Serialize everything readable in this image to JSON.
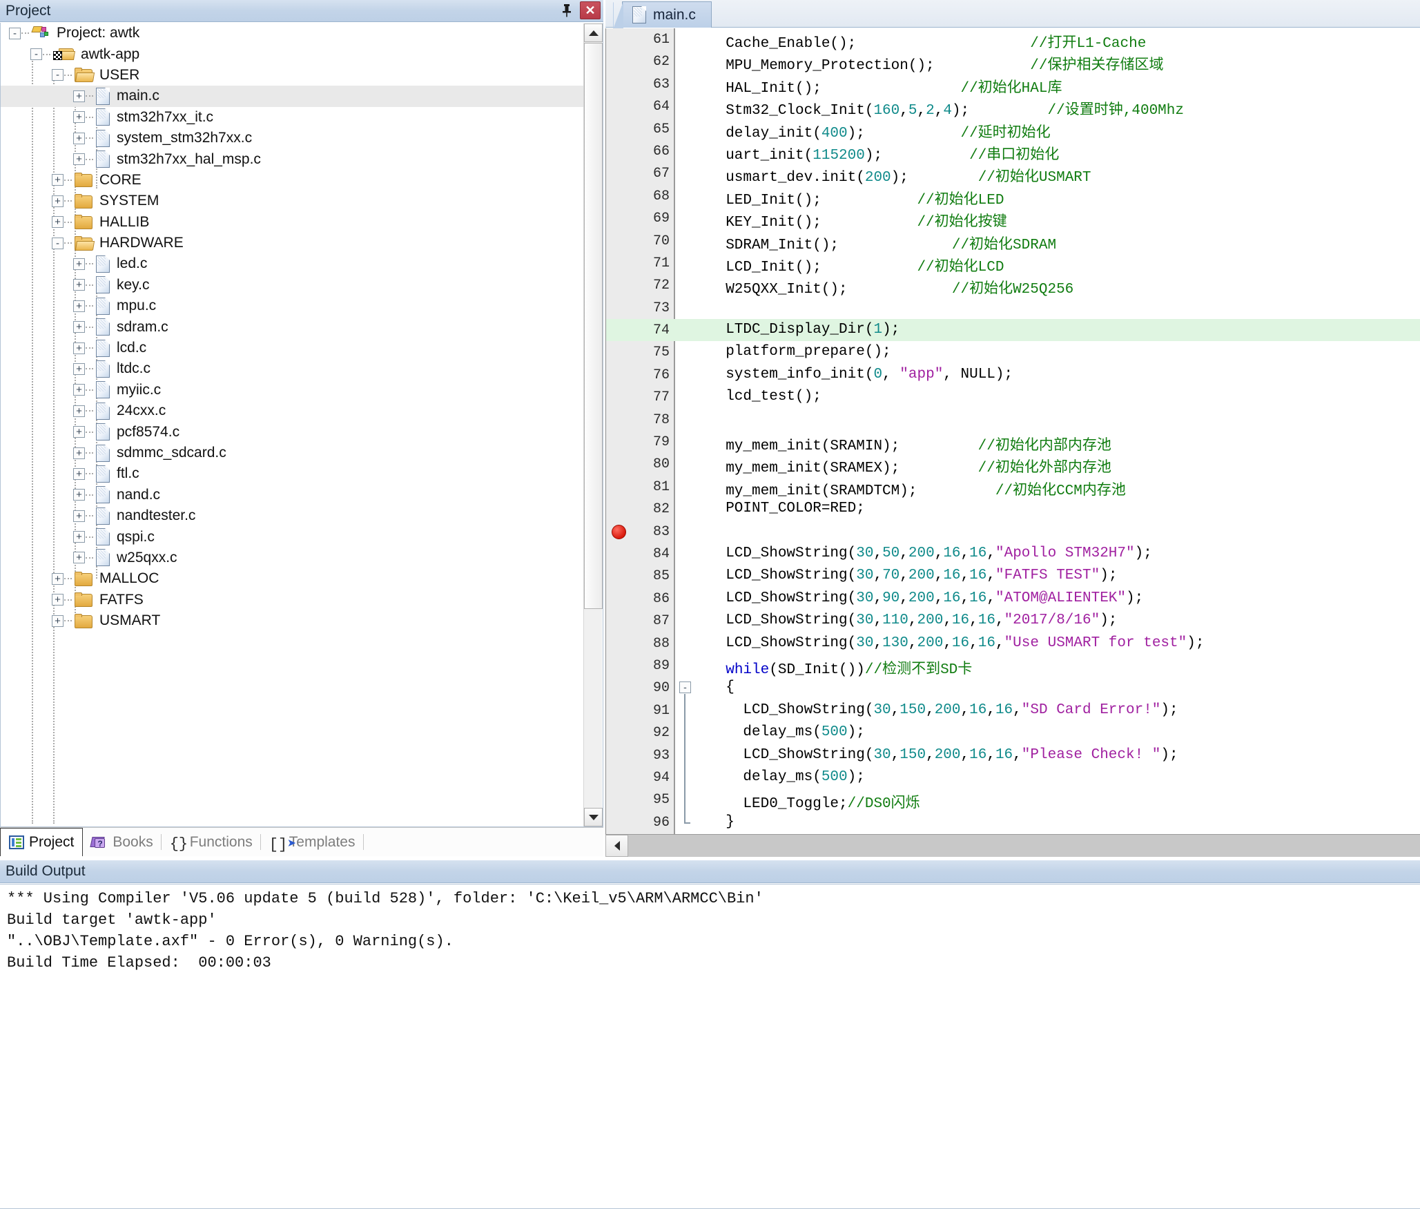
{
  "project_pane": {
    "title": "Project",
    "pin_icon": "pin-icon",
    "close_icon": "close-icon",
    "tree": [
      {
        "indent": 0,
        "toggle": "-",
        "icon": "project-icon",
        "label": "Project: awtk",
        "selected": false
      },
      {
        "indent": 1,
        "toggle": "-",
        "icon": "target-icon",
        "label": "awtk-app",
        "selected": false
      },
      {
        "indent": 2,
        "toggle": "-",
        "icon": "folder-open",
        "label": "USER",
        "selected": false
      },
      {
        "indent": 3,
        "toggle": "+",
        "icon": "file-icon",
        "label": "main.c",
        "selected": true
      },
      {
        "indent": 3,
        "toggle": "+",
        "icon": "file-icon",
        "label": "stm32h7xx_it.c",
        "selected": false
      },
      {
        "indent": 3,
        "toggle": "+",
        "icon": "file-icon",
        "label": "system_stm32h7xx.c",
        "selected": false
      },
      {
        "indent": 3,
        "toggle": "+",
        "icon": "file-icon",
        "label": "stm32h7xx_hal_msp.c",
        "selected": false
      },
      {
        "indent": 2,
        "toggle": "+",
        "icon": "folder",
        "label": "CORE",
        "selected": false
      },
      {
        "indent": 2,
        "toggle": "+",
        "icon": "folder",
        "label": "SYSTEM",
        "selected": false
      },
      {
        "indent": 2,
        "toggle": "+",
        "icon": "folder",
        "label": "HALLIB",
        "selected": false
      },
      {
        "indent": 2,
        "toggle": "-",
        "icon": "folder-open",
        "label": "HARDWARE",
        "selected": false
      },
      {
        "indent": 3,
        "toggle": "+",
        "icon": "file-icon",
        "label": "led.c",
        "selected": false
      },
      {
        "indent": 3,
        "toggle": "+",
        "icon": "file-icon",
        "label": "key.c",
        "selected": false
      },
      {
        "indent": 3,
        "toggle": "+",
        "icon": "file-icon",
        "label": "mpu.c",
        "selected": false
      },
      {
        "indent": 3,
        "toggle": "+",
        "icon": "file-icon",
        "label": "sdram.c",
        "selected": false
      },
      {
        "indent": 3,
        "toggle": "+",
        "icon": "file-icon",
        "label": "lcd.c",
        "selected": false
      },
      {
        "indent": 3,
        "toggle": "+",
        "icon": "file-icon",
        "label": "ltdc.c",
        "selected": false
      },
      {
        "indent": 3,
        "toggle": "+",
        "icon": "file-icon",
        "label": "myiic.c",
        "selected": false
      },
      {
        "indent": 3,
        "toggle": "+",
        "icon": "file-icon",
        "label": "24cxx.c",
        "selected": false
      },
      {
        "indent": 3,
        "toggle": "+",
        "icon": "file-icon",
        "label": "pcf8574.c",
        "selected": false
      },
      {
        "indent": 3,
        "toggle": "+",
        "icon": "file-icon",
        "label": "sdmmc_sdcard.c",
        "selected": false
      },
      {
        "indent": 3,
        "toggle": "+",
        "icon": "file-icon",
        "label": "ftl.c",
        "selected": false
      },
      {
        "indent": 3,
        "toggle": "+",
        "icon": "file-icon",
        "label": "nand.c",
        "selected": false
      },
      {
        "indent": 3,
        "toggle": "+",
        "icon": "file-icon",
        "label": "nandtester.c",
        "selected": false
      },
      {
        "indent": 3,
        "toggle": "+",
        "icon": "file-icon",
        "label": "qspi.c",
        "selected": false
      },
      {
        "indent": 3,
        "toggle": "+",
        "icon": "file-icon",
        "label": "w25qxx.c",
        "selected": false
      },
      {
        "indent": 2,
        "toggle": "+",
        "icon": "folder",
        "label": "MALLOC",
        "selected": false
      },
      {
        "indent": 2,
        "toggle": "+",
        "icon": "folder",
        "label": "FATFS",
        "selected": false
      },
      {
        "indent": 2,
        "toggle": "+",
        "icon": "folder",
        "label": "USMART",
        "selected": false
      }
    ],
    "tabs": [
      {
        "label": "Project",
        "icon": "project-list-icon",
        "active": true
      },
      {
        "label": "Books",
        "icon": "books-icon",
        "active": false
      },
      {
        "label": "Functions",
        "icon": "functions-icon",
        "active": false
      },
      {
        "label": "Templates",
        "icon": "templates-icon",
        "active": false
      }
    ],
    "scrollbar": {
      "up_icon": "scroll-up-arrow",
      "down_icon": "scroll-down-arrow"
    }
  },
  "editor": {
    "tab": {
      "label": "main.c",
      "icon": "file-icon",
      "active": true
    },
    "hscroll_left_icon": "scroll-left-arrow",
    "breakpoint_line": 83,
    "highlight_line": 74,
    "lines": [
      {
        "num": 61,
        "tokens": [
          {
            "t": "  Cache_Enable();",
            "c": "p"
          },
          {
            "t": "                    //打开L1-Cache",
            "c": "c"
          }
        ]
      },
      {
        "num": 62,
        "tokens": [
          {
            "t": "  MPU_Memory_Protection();",
            "c": "p"
          },
          {
            "t": "           //保护相关存储区域",
            "c": "c"
          }
        ]
      },
      {
        "num": 63,
        "tokens": [
          {
            "t": "  HAL_Init();",
            "c": "p"
          },
          {
            "t": "                //初始化HAL库",
            "c": "c"
          }
        ]
      },
      {
        "num": 64,
        "tokens": [
          {
            "t": "  Stm32_Clock_Init(",
            "c": "p"
          },
          {
            "t": "160",
            "c": "n"
          },
          {
            "t": ",",
            "c": "p"
          },
          {
            "t": "5",
            "c": "n"
          },
          {
            "t": ",",
            "c": "p"
          },
          {
            "t": "2",
            "c": "n"
          },
          {
            "t": ",",
            "c": "p"
          },
          {
            "t": "4",
            "c": "n"
          },
          {
            "t": ");",
            "c": "p"
          },
          {
            "t": "         //设置时钟,400Mhz",
            "c": "c"
          }
        ]
      },
      {
        "num": 65,
        "tokens": [
          {
            "t": "  delay_init(",
            "c": "p"
          },
          {
            "t": "400",
            "c": "n"
          },
          {
            "t": ");",
            "c": "p"
          },
          {
            "t": "           //延时初始化",
            "c": "c"
          }
        ]
      },
      {
        "num": 66,
        "tokens": [
          {
            "t": "  uart_init(",
            "c": "p"
          },
          {
            "t": "115200",
            "c": "n"
          },
          {
            "t": ");",
            "c": "p"
          },
          {
            "t": "          //串口初始化",
            "c": "c"
          }
        ]
      },
      {
        "num": 67,
        "tokens": [
          {
            "t": "  usmart_dev.init(",
            "c": "p"
          },
          {
            "t": "200",
            "c": "n"
          },
          {
            "t": ");",
            "c": "p"
          },
          {
            "t": "        //初始化USMART",
            "c": "c"
          }
        ]
      },
      {
        "num": 68,
        "tokens": [
          {
            "t": "  LED_Init();",
            "c": "p"
          },
          {
            "t": "           //初始化LED",
            "c": "c"
          }
        ]
      },
      {
        "num": 69,
        "tokens": [
          {
            "t": "  KEY_Init();",
            "c": "p"
          },
          {
            "t": "           //初始化按键",
            "c": "c"
          }
        ]
      },
      {
        "num": 70,
        "tokens": [
          {
            "t": "  SDRAM_Init();",
            "c": "p"
          },
          {
            "t": "             //初始化SDRAM",
            "c": "c"
          }
        ]
      },
      {
        "num": 71,
        "tokens": [
          {
            "t": "  LCD_Init();",
            "c": "p"
          },
          {
            "t": "           //初始化LCD",
            "c": "c"
          }
        ]
      },
      {
        "num": 72,
        "tokens": [
          {
            "t": "  W25QXX_Init();",
            "c": "p"
          },
          {
            "t": "            //初始化W25Q256",
            "c": "c"
          }
        ]
      },
      {
        "num": 73,
        "tokens": []
      },
      {
        "num": 74,
        "tokens": [
          {
            "t": "  LTDC_Display_Dir(",
            "c": "p"
          },
          {
            "t": "1",
            "c": "n"
          },
          {
            "t": ");",
            "c": "p"
          }
        ]
      },
      {
        "num": 75,
        "tokens": [
          {
            "t": "  platform_prepare();",
            "c": "p"
          }
        ]
      },
      {
        "num": 76,
        "tokens": [
          {
            "t": "  system_info_init(",
            "c": "p"
          },
          {
            "t": "0",
            "c": "n"
          },
          {
            "t": ", ",
            "c": "p"
          },
          {
            "t": "\"app\"",
            "c": "s"
          },
          {
            "t": ", NULL);",
            "c": "p"
          }
        ]
      },
      {
        "num": 77,
        "tokens": [
          {
            "t": "  lcd_test();",
            "c": "p"
          }
        ]
      },
      {
        "num": 78,
        "tokens": []
      },
      {
        "num": 79,
        "tokens": [
          {
            "t": "  my_mem_init(SRAMIN);",
            "c": "p"
          },
          {
            "t": "         //初始化内部内存池",
            "c": "c"
          }
        ]
      },
      {
        "num": 80,
        "tokens": [
          {
            "t": "  my_mem_init(SRAMEX);",
            "c": "p"
          },
          {
            "t": "         //初始化外部内存池",
            "c": "c"
          }
        ]
      },
      {
        "num": 81,
        "tokens": [
          {
            "t": "  my_mem_init(SRAMDTCM);",
            "c": "p"
          },
          {
            "t": "         //初始化CCM内存池",
            "c": "c"
          }
        ]
      },
      {
        "num": 82,
        "tokens": [
          {
            "t": "  POINT_COLOR=RED;",
            "c": "p"
          }
        ]
      },
      {
        "num": 83,
        "tokens": []
      },
      {
        "num": 84,
        "tokens": [
          {
            "t": "  LCD_ShowString(",
            "c": "p"
          },
          {
            "t": "30",
            "c": "n"
          },
          {
            "t": ",",
            "c": "p"
          },
          {
            "t": "50",
            "c": "n"
          },
          {
            "t": ",",
            "c": "p"
          },
          {
            "t": "200",
            "c": "n"
          },
          {
            "t": ",",
            "c": "p"
          },
          {
            "t": "16",
            "c": "n"
          },
          {
            "t": ",",
            "c": "p"
          },
          {
            "t": "16",
            "c": "n"
          },
          {
            "t": ",",
            "c": "p"
          },
          {
            "t": "\"Apollo STM32H7\"",
            "c": "s"
          },
          {
            "t": ");",
            "c": "p"
          }
        ]
      },
      {
        "num": 85,
        "tokens": [
          {
            "t": "  LCD_ShowString(",
            "c": "p"
          },
          {
            "t": "30",
            "c": "n"
          },
          {
            "t": ",",
            "c": "p"
          },
          {
            "t": "70",
            "c": "n"
          },
          {
            "t": ",",
            "c": "p"
          },
          {
            "t": "200",
            "c": "n"
          },
          {
            "t": ",",
            "c": "p"
          },
          {
            "t": "16",
            "c": "n"
          },
          {
            "t": ",",
            "c": "p"
          },
          {
            "t": "16",
            "c": "n"
          },
          {
            "t": ",",
            "c": "p"
          },
          {
            "t": "\"FATFS TEST\"",
            "c": "s"
          },
          {
            "t": ");",
            "c": "p"
          }
        ]
      },
      {
        "num": 86,
        "tokens": [
          {
            "t": "  LCD_ShowString(",
            "c": "p"
          },
          {
            "t": "30",
            "c": "n"
          },
          {
            "t": ",",
            "c": "p"
          },
          {
            "t": "90",
            "c": "n"
          },
          {
            "t": ",",
            "c": "p"
          },
          {
            "t": "200",
            "c": "n"
          },
          {
            "t": ",",
            "c": "p"
          },
          {
            "t": "16",
            "c": "n"
          },
          {
            "t": ",",
            "c": "p"
          },
          {
            "t": "16",
            "c": "n"
          },
          {
            "t": ",",
            "c": "p"
          },
          {
            "t": "\"ATOM@ALIENTEK\"",
            "c": "s"
          },
          {
            "t": ");",
            "c": "p"
          }
        ]
      },
      {
        "num": 87,
        "tokens": [
          {
            "t": "  LCD_ShowString(",
            "c": "p"
          },
          {
            "t": "30",
            "c": "n"
          },
          {
            "t": ",",
            "c": "p"
          },
          {
            "t": "110",
            "c": "n"
          },
          {
            "t": ",",
            "c": "p"
          },
          {
            "t": "200",
            "c": "n"
          },
          {
            "t": ",",
            "c": "p"
          },
          {
            "t": "16",
            "c": "n"
          },
          {
            "t": ",",
            "c": "p"
          },
          {
            "t": "16",
            "c": "n"
          },
          {
            "t": ",",
            "c": "p"
          },
          {
            "t": "\"2017/8/16\"",
            "c": "s"
          },
          {
            "t": ");",
            "c": "p"
          }
        ]
      },
      {
        "num": 88,
        "tokens": [
          {
            "t": "  LCD_ShowString(",
            "c": "p"
          },
          {
            "t": "30",
            "c": "n"
          },
          {
            "t": ",",
            "c": "p"
          },
          {
            "t": "130",
            "c": "n"
          },
          {
            "t": ",",
            "c": "p"
          },
          {
            "t": "200",
            "c": "n"
          },
          {
            "t": ",",
            "c": "p"
          },
          {
            "t": "16",
            "c": "n"
          },
          {
            "t": ",",
            "c": "p"
          },
          {
            "t": "16",
            "c": "n"
          },
          {
            "t": ",",
            "c": "p"
          },
          {
            "t": "\"Use USMART for test\"",
            "c": "s"
          },
          {
            "t": ");",
            "c": "p"
          }
        ]
      },
      {
        "num": 89,
        "tokens": [
          {
            "t": "  ",
            "c": "p"
          },
          {
            "t": "while",
            "c": "k"
          },
          {
            "t": "(SD_Init())",
            "c": "p"
          },
          {
            "t": "//检测不到SD卡",
            "c": "c"
          }
        ]
      },
      {
        "num": 90,
        "tokens": [
          {
            "t": "  {",
            "c": "p"
          }
        ],
        "fold": "-"
      },
      {
        "num": 91,
        "tokens": [
          {
            "t": "    LCD_ShowString(",
            "c": "p"
          },
          {
            "t": "30",
            "c": "n"
          },
          {
            "t": ",",
            "c": "p"
          },
          {
            "t": "150",
            "c": "n"
          },
          {
            "t": ",",
            "c": "p"
          },
          {
            "t": "200",
            "c": "n"
          },
          {
            "t": ",",
            "c": "p"
          },
          {
            "t": "16",
            "c": "n"
          },
          {
            "t": ",",
            "c": "p"
          },
          {
            "t": "16",
            "c": "n"
          },
          {
            "t": ",",
            "c": "p"
          },
          {
            "t": "\"SD Card Error!\"",
            "c": "s"
          },
          {
            "t": ");",
            "c": "p"
          }
        ]
      },
      {
        "num": 92,
        "tokens": [
          {
            "t": "    delay_ms(",
            "c": "p"
          },
          {
            "t": "500",
            "c": "n"
          },
          {
            "t": ");",
            "c": "p"
          }
        ]
      },
      {
        "num": 93,
        "tokens": [
          {
            "t": "    LCD_ShowString(",
            "c": "p"
          },
          {
            "t": "30",
            "c": "n"
          },
          {
            "t": ",",
            "c": "p"
          },
          {
            "t": "150",
            "c": "n"
          },
          {
            "t": ",",
            "c": "p"
          },
          {
            "t": "200",
            "c": "n"
          },
          {
            "t": ",",
            "c": "p"
          },
          {
            "t": "16",
            "c": "n"
          },
          {
            "t": ",",
            "c": "p"
          },
          {
            "t": "16",
            "c": "n"
          },
          {
            "t": ",",
            "c": "p"
          },
          {
            "t": "\"Please Check! \"",
            "c": "s"
          },
          {
            "t": ");",
            "c": "p"
          }
        ]
      },
      {
        "num": 94,
        "tokens": [
          {
            "t": "    delay_ms(",
            "c": "p"
          },
          {
            "t": "500",
            "c": "n"
          },
          {
            "t": ");",
            "c": "p"
          }
        ]
      },
      {
        "num": 95,
        "tokens": [
          {
            "t": "    LED0_Toggle;",
            "c": "p"
          },
          {
            "t": "//DS0闪烁",
            "c": "c"
          }
        ]
      },
      {
        "num": 96,
        "tokens": [
          {
            "t": "  }",
            "c": "p"
          }
        ],
        "foldend": true
      }
    ]
  },
  "build_output": {
    "title": "Build Output",
    "lines": [
      "*** Using Compiler 'V5.06 update 5 (build 528)', folder: 'C:\\Keil_v5\\ARM\\ARMCC\\Bin'",
      "Build target 'awtk-app'",
      "\"..\\OBJ\\Template.axf\" - 0 Error(s), 0 Warning(s).",
      "Build Time Elapsed:  00:00:03"
    ]
  },
  "colors": {
    "title_bar": "#c3d4e8",
    "close_button": "#b83a48",
    "selected_row": "#e9e9e9",
    "highlight_line": "#dff5e1",
    "breakpoint": "#d81a0d",
    "comment": "#107c10",
    "string": "#a020a0",
    "number": "#0f8a8a",
    "keyword": "#0000c8"
  }
}
